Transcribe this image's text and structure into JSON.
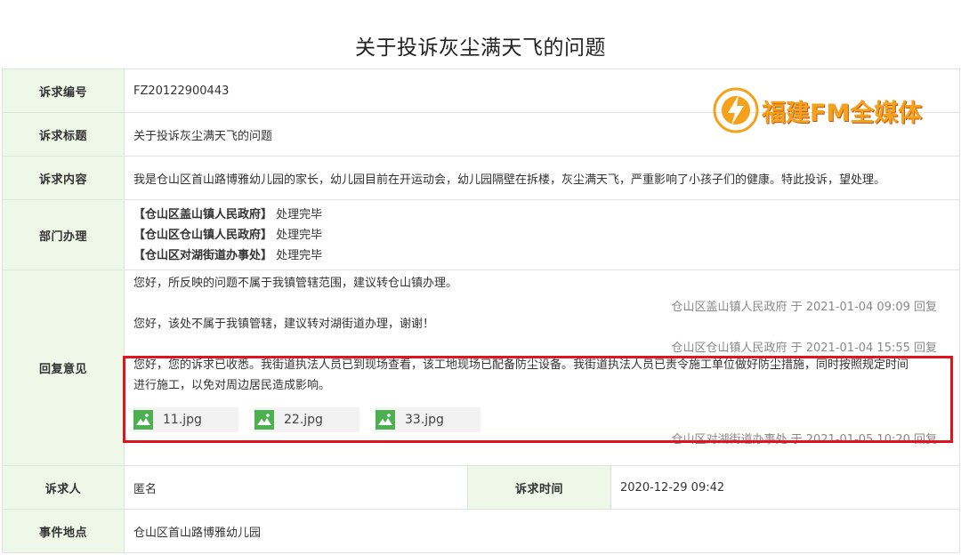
{
  "page_title": "关于投诉灰尘满天飞的问题",
  "logo_text": "福建FM全媒体",
  "fields": {
    "id_label": "诉求编号",
    "id_value": "FZ20122900443",
    "title_label": "诉求标题",
    "title_value": "关于投诉灰尘满天飞的问题",
    "content_label": "诉求内容",
    "content_value": "我是仓山区首山路博雅幼儿园的家长，幼儿园目前在开运动会，幼儿园隔壁在拆楼，灰尘满天飞，严重影响了小孩子们的健康。特此投诉，望处理。",
    "dept_label": "部门办理",
    "departments": [
      {
        "name": "【仓山区盖山镇人民政府】",
        "status": "处理完毕"
      },
      {
        "name": "【仓山区仓山镇人民政府】",
        "status": "处理完毕"
      },
      {
        "name": "【仓山区对湖街道办事处】",
        "status": "处理完毕"
      }
    ],
    "reply_label": "回复意见",
    "replies": [
      {
        "text1": "您好，所反映的问题不属于我镇管辖范围，建议转仓山镇办理。",
        "meta": "仓山区盖山镇人民政府 于 2021-01-04 09:09 回复"
      },
      {
        "text1": "您好，该处不属于我镇管辖，建议转对湖街道办理，谢谢！",
        "meta": "仓山区仓山镇人民政府 于 2021-01-04 15:55 回复"
      },
      {
        "text1": "您好，您的诉求已收悉。我街道执法人员已到现场查看，该工地现场已配备防尘设备。我街道执法人员已责令施工单位做好防尘措施，同时按照规定时间",
        "text2": "进行施工，以免对周边居民造成影响。",
        "attachments": [
          "11.jpg",
          "22.jpg",
          "33.jpg"
        ],
        "meta": "仓山区对湖街道办事处 于 2021-01-05 10:20 回复"
      }
    ],
    "petitioner_label": "诉求人",
    "petitioner_value": "匿名",
    "time_label": "诉求时间",
    "time_value": "2020-12-29 09:42",
    "location_label": "事件地点",
    "location_value": "仓山区首山路博雅幼儿园"
  },
  "colors": {
    "label_bg": "#eef7e8",
    "label_text": "#6aa84f",
    "highlight_border": "#e0141c",
    "attachment_icon": "#4caf50",
    "logo": "#f5a21a"
  },
  "icons": {
    "attachment": "image-icon",
    "logo": "radio-wave-logo-icon"
  }
}
